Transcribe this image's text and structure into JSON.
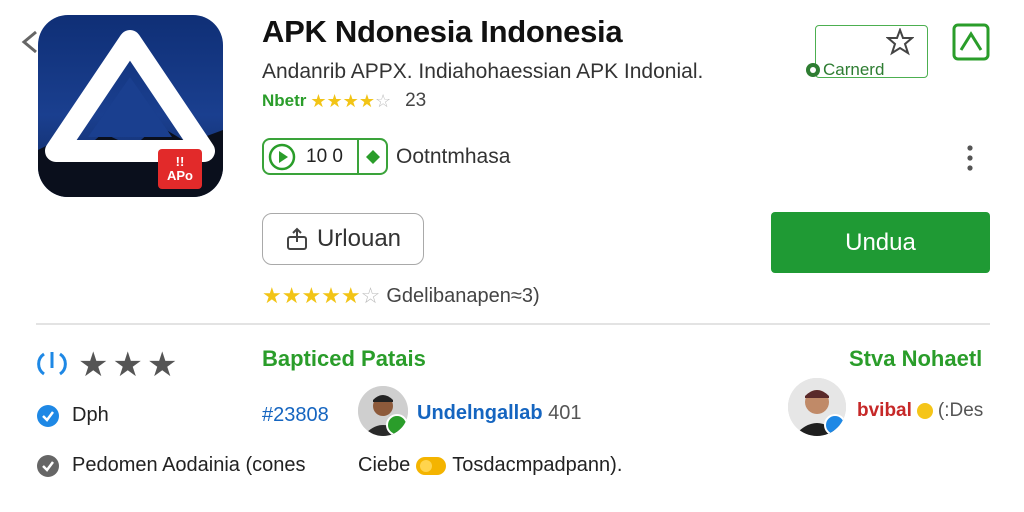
{
  "app": {
    "title": "APK Ndonesia Indonesia",
    "subtitle": "Andanrib APPX. Indiahohaessian APK Indonial.",
    "rating_label": "Nbetr",
    "rating_stars": 4,
    "rating_count": "23",
    "download_count": "10 0",
    "category": "Ootntmhasa",
    "icon_badge_top": "!!",
    "icon_badge_text": "APo"
  },
  "actions": {
    "wishlist_label": "Carnerd",
    "upload_label": "Urlouan",
    "install_label": "Undua"
  },
  "review_summary": {
    "stars": 5,
    "text": "Gdelibanapen≈3)"
  },
  "details": {
    "feature_title": "Bapticed Patais",
    "developer_name": "Stva Nohaetl",
    "row2_label": "Dph",
    "code": "#23808",
    "user1_name": "Undelngallab",
    "user1_count": "401",
    "user2_name": "bvibal",
    "user2_meta": "(:Des",
    "row3_label": "Pedomen Aodainia (cones",
    "row3_extra_a": "Ciebe",
    "row3_extra_b": "Tosdacmpadpann)."
  },
  "colors": {
    "accent_green": "#1f9a34",
    "star_yellow": "#f2c416",
    "link_blue": "#1565c0",
    "icon_bg": "#12357f",
    "badge_red": "#e22a2a"
  },
  "icons": [
    "back-icon",
    "play-icon",
    "diamond-icon",
    "more-icon",
    "wishlist-star-icon",
    "share-icon",
    "upload-icon",
    "toggle-icon",
    "check-icon",
    "info-icon"
  ]
}
